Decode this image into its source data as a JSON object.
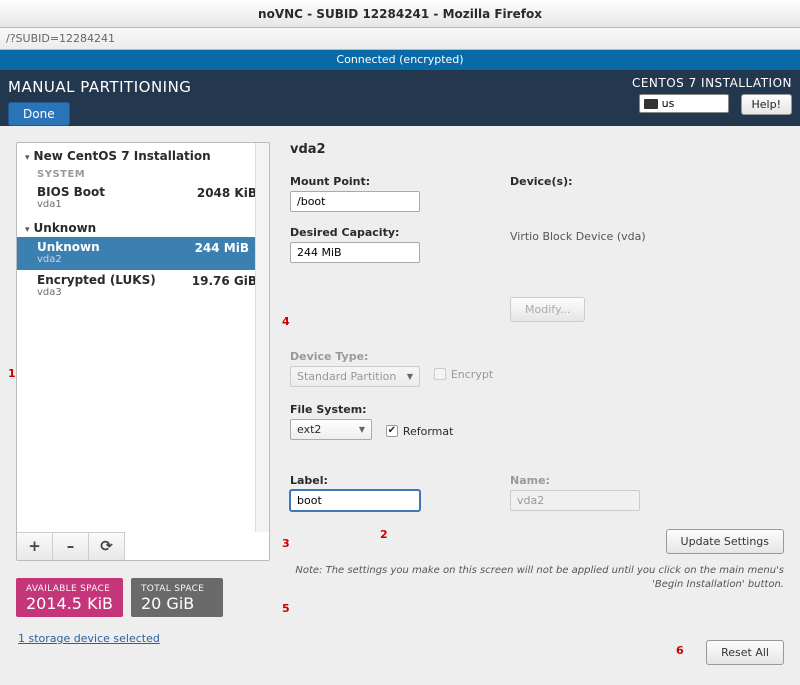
{
  "window": {
    "title": "noVNC - SUBID 12284241 - Mozilla Firefox"
  },
  "urlbar": "/?SUBID=12284241",
  "conn_status": "Connected (encrypted)",
  "header": {
    "title": "MANUAL PARTITIONING",
    "done": "Done",
    "installer": "CENTOS 7 INSTALLATION",
    "lang": "us",
    "help": "Help!"
  },
  "tree": {
    "install_header": "New CentOS 7 Installation",
    "system_cat": "SYSTEM",
    "bios": {
      "name": "BIOS Boot",
      "dev": "vda1",
      "size": "2048 KiB"
    },
    "unknown_header": "Unknown",
    "unknown": {
      "name": "Unknown",
      "dev": "vda2",
      "size": "244 MiB"
    },
    "luks": {
      "name": "Encrypted (LUKS)",
      "dev": "vda3",
      "size": "19.76 GiB"
    },
    "add": "+",
    "remove": "–",
    "reload": "⟳"
  },
  "space": {
    "avail_label": "AVAILABLE SPACE",
    "avail_value": "2014.5 KiB",
    "total_label": "TOTAL SPACE",
    "total_value": "20 GiB"
  },
  "storage_link": "1 storage device selected",
  "details": {
    "title": "vda2",
    "mountpoint_label": "Mount Point:",
    "mountpoint_value": "/boot",
    "capacity_label": "Desired Capacity:",
    "capacity_value": "244 MiB",
    "devices_label": "Device(s):",
    "device_name": "Virtio Block Device (vda)",
    "modify": "Modify...",
    "devtype_label": "Device Type:",
    "devtype_value": "Standard Partition",
    "encrypt": "Encrypt",
    "fs_label": "File System:",
    "fs_value": "ext2",
    "reformat": "Reformat",
    "label_label": "Label:",
    "label_value": "boot",
    "name_label": "Name:",
    "name_value": "vda2",
    "update": "Update Settings",
    "note": "Note:  The settings you make on this screen will not be applied until you click on the main menu's 'Begin Installation' button.",
    "reset": "Reset All"
  },
  "markers": {
    "m1": "1",
    "m2": "2",
    "m3": "3",
    "m4": "4",
    "m5": "5",
    "m6": "6"
  }
}
